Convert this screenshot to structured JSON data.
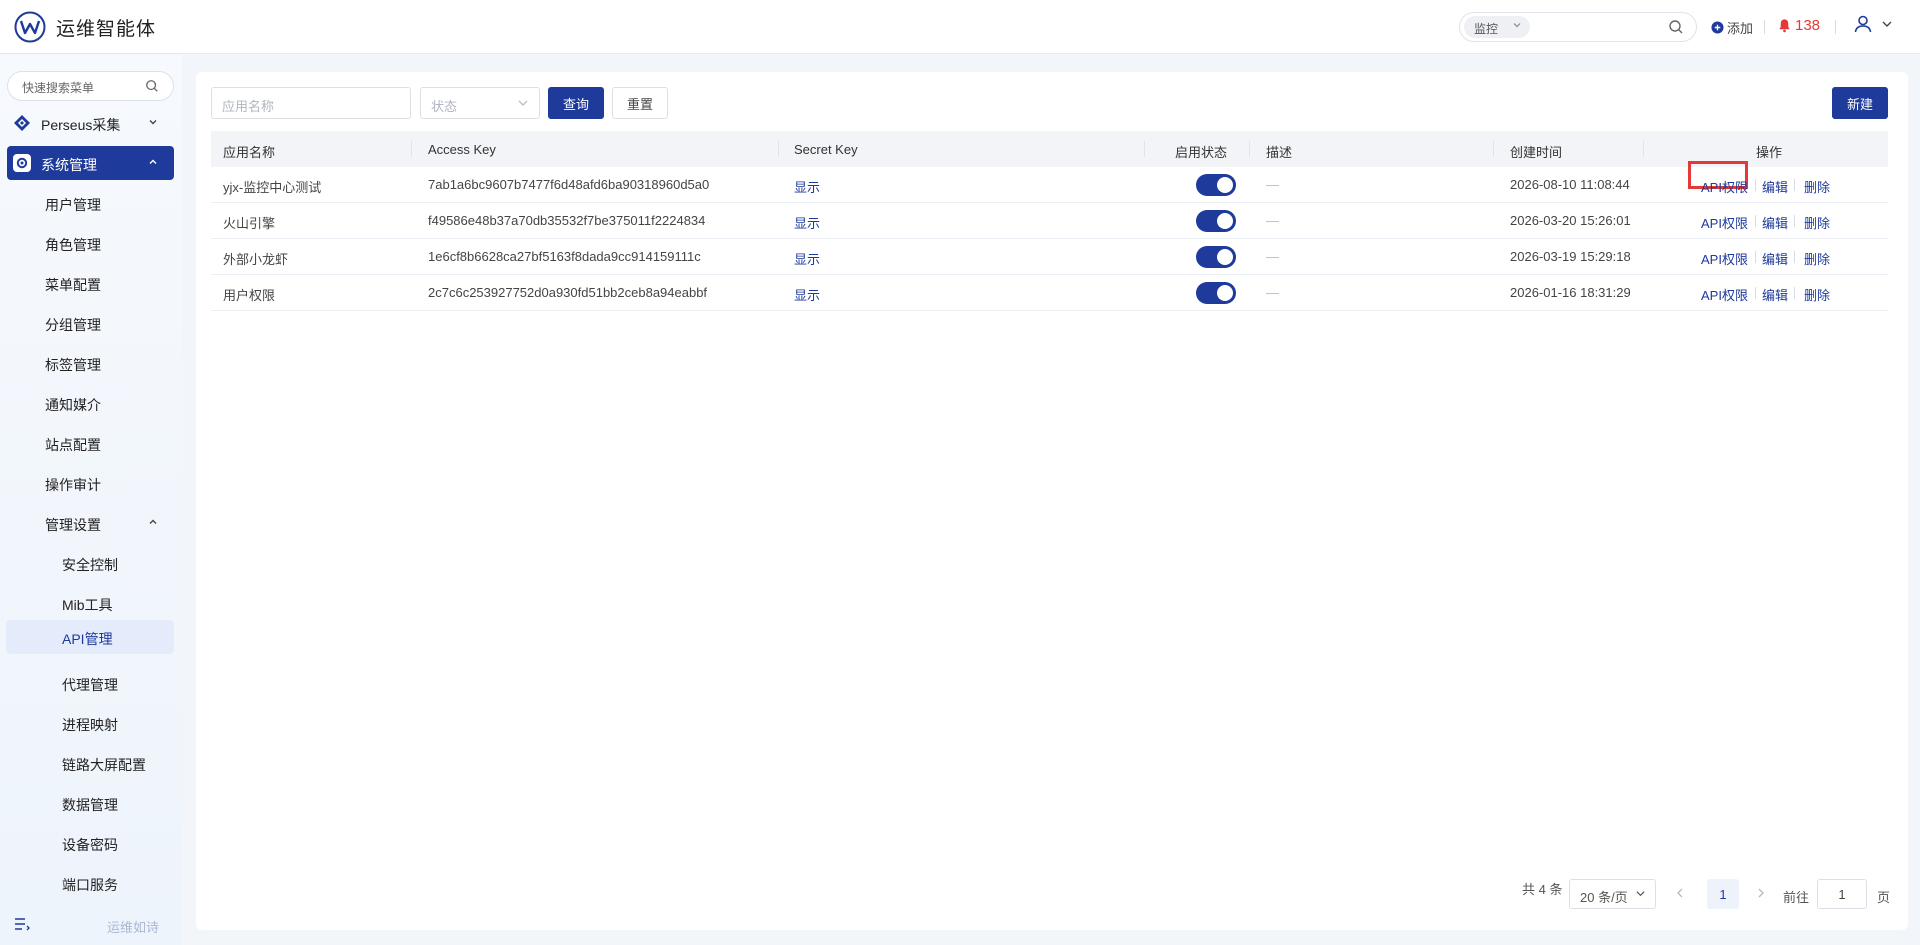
{
  "header": {
    "app_title": "运维智能体",
    "search_scope": "监控",
    "search_value": "",
    "add_label": "添加",
    "alert_count": "138"
  },
  "sidebar": {
    "search_placeholder": "快速搜索菜单",
    "top_items": [
      {
        "label": "Perseus采集",
        "icon": "diamond-icon",
        "expanded": false
      },
      {
        "label": "系统管理",
        "icon": "settings-icon",
        "expanded": true
      }
    ],
    "items": [
      {
        "label": "用户管理"
      },
      {
        "label": "角色管理"
      },
      {
        "label": "菜单配置"
      },
      {
        "label": "分组管理"
      },
      {
        "label": "标签管理"
      },
      {
        "label": "通知媒介"
      },
      {
        "label": "站点配置"
      },
      {
        "label": "操作审计"
      },
      {
        "label": "管理设置"
      }
    ],
    "sub_items": [
      {
        "label": "安全控制"
      },
      {
        "label": "Mib工具"
      },
      {
        "label": "API管理"
      },
      {
        "label": "代理管理"
      },
      {
        "label": "进程映射"
      },
      {
        "label": "链路大屏配置"
      },
      {
        "label": "数据管理"
      },
      {
        "label": "设备密码"
      },
      {
        "label": "端口服务"
      }
    ],
    "footer_text": "运维如诗"
  },
  "filters": {
    "app_name_placeholder": "应用名称",
    "status_placeholder": "状态",
    "query_label": "查询",
    "reset_label": "重置",
    "new_label": "新建"
  },
  "table": {
    "columns": [
      "应用名称",
      "Access Key",
      "Secret Key",
      "启用状态",
      "描述",
      "创建时间",
      "操作"
    ],
    "rows": [
      {
        "name": "yjx-监控中心测试",
        "access_key": "7ab1a6bc9607b7477f6d48afd6ba90318960d5a0",
        "secret": "显示",
        "enabled": true,
        "desc": "—",
        "created": "2026-08-10 11:08:44"
      },
      {
        "name": "火山引擎",
        "access_key": "f49586e48b37a70db35532f7be375011f2224834",
        "secret": "显示",
        "enabled": true,
        "desc": "—",
        "created": "2026-03-20 15:26:01"
      },
      {
        "name": "外部小龙虾",
        "access_key": "1e6cf8b6628ca27bf5163f8dada9cc914159111c",
        "secret": "显示",
        "enabled": true,
        "desc": "—",
        "created": "2026-03-19 15:29:18"
      },
      {
        "name": "用户权限",
        "access_key": "2c7c6c253927752d0a930fd51bb2ceb8a94eabbf",
        "secret": "显示",
        "enabled": true,
        "desc": "—",
        "created": "2026-01-16 18:31:29"
      }
    ],
    "ops": {
      "api": "API权限",
      "edit": "编辑",
      "delete": "删除"
    }
  },
  "pagination": {
    "total": "共 4 条",
    "page_size": "20 条/页",
    "current_page": "1",
    "goto_label": "前往",
    "goto_value": "1",
    "page_unit": "页"
  },
  "colors": {
    "primary": "#1e3a9a",
    "alert": "#e53935",
    "highlight_box": "#e53935"
  }
}
